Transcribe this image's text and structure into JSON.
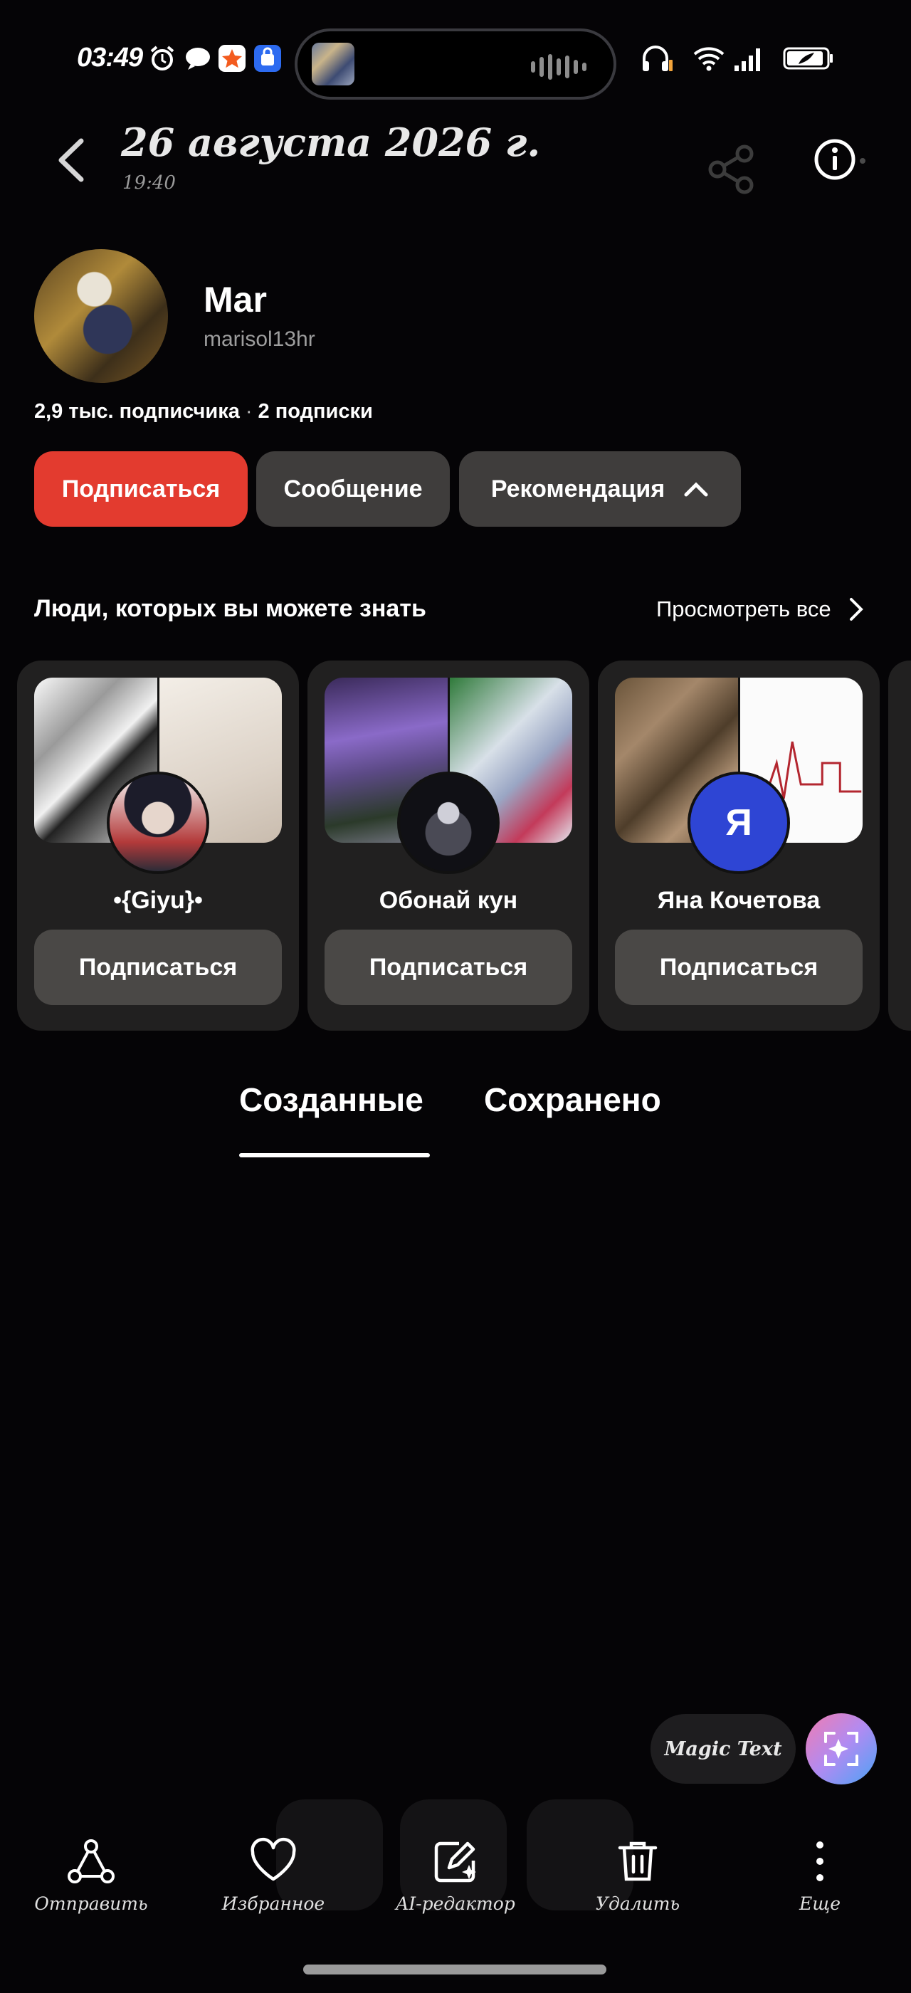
{
  "status_bar": {
    "time": "03:49",
    "icons": [
      "alarm-icon",
      "chat-bubble-icon",
      "star-app-icon",
      "app-store-icon",
      "headphones-icon",
      "wifi-icon",
      "signal-icon",
      "battery-icon"
    ],
    "island": {
      "icons": [
        "album-art-icon",
        "audio-wave-icon"
      ]
    }
  },
  "header": {
    "title": "26 августа 2026 г.",
    "subtitle": "19:40",
    "icons": [
      "back-arrow-icon",
      "share-icon",
      "info-icon"
    ]
  },
  "profile": {
    "name": "Mar",
    "username": "marisol13hr",
    "followers": "2,9 тыс. подписчика",
    "separator": "·",
    "following": "2 подписки",
    "buttons": {
      "follow": "Подписаться",
      "message": "Сообщение",
      "recommend": "Рекомендация"
    }
  },
  "people": {
    "title": "Люди, которых вы можете знать",
    "see_all": "Просмотреть все",
    "cards": [
      {
        "name": "•{Giyu}•",
        "button": "Подписаться"
      },
      {
        "name": "Обонай кун",
        "button": "Подписаться"
      },
      {
        "name": "Яна Кочетова",
        "button": "Подписаться",
        "avatar_letter": "Я"
      }
    ]
  },
  "tabs": [
    {
      "label": "Созданные",
      "active": true
    },
    {
      "label": "Сохранено",
      "active": false
    }
  ],
  "magic": {
    "label": "Magic Text"
  },
  "toolbar": [
    {
      "icon": "share-nodes-icon",
      "label": "Отправить"
    },
    {
      "icon": "heart-icon",
      "label": "Избранное"
    },
    {
      "icon": "ai-edit-icon",
      "label": "AI-редактор"
    },
    {
      "icon": "trash-icon",
      "label": "Удалить"
    },
    {
      "icon": "more-vertical-icon",
      "label": "Еще"
    }
  ],
  "colors": {
    "background": "#050406",
    "follow_button": "#e33b2f",
    "secondary_button": "#3f3d3c",
    "card": "#212020",
    "avatar_letter_bg": "#2e45d4"
  }
}
